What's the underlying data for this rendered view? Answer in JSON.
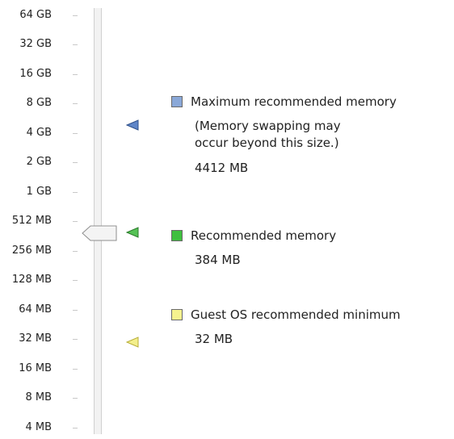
{
  "memory_scale": {
    "labels": [
      "64 GB",
      "32 GB",
      "16 GB",
      "8 GB",
      "4 GB",
      "2 GB",
      "1 GB",
      "512 MB",
      "256 MB",
      "128 MB",
      "64 MB",
      "32 MB",
      "16 MB",
      "8 MB",
      "4 MB"
    ],
    "selected_value": "384 MB"
  },
  "legend": {
    "maximum": {
      "label": "Maximum recommended memory",
      "note_line1": "(Memory swapping may",
      "note_line2": "occur beyond this size.)",
      "value": "4412 MB",
      "color": "#8aa8d8"
    },
    "recommended": {
      "label": "Recommended memory",
      "value": "384 MB",
      "color": "#3fbf3f"
    },
    "minimum": {
      "label": "Guest OS recommended minimum",
      "value": "32 MB",
      "color": "#f5f28f"
    }
  }
}
